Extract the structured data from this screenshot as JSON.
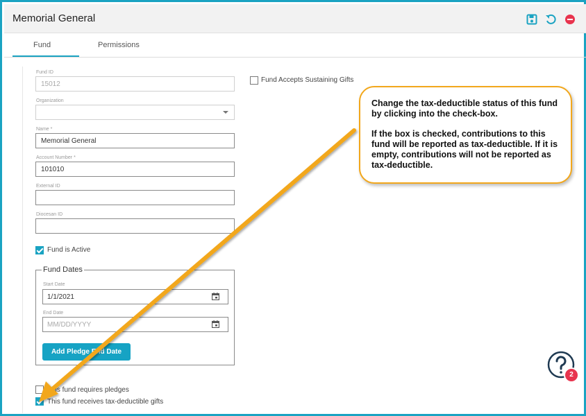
{
  "header": {
    "title": "Memorial General",
    "save_icon": "save-icon",
    "undo_icon": "undo-icon",
    "delete_icon": "remove-icon"
  },
  "tabs": [
    {
      "label": "Fund",
      "active": true
    },
    {
      "label": "Permissions",
      "active": false
    }
  ],
  "form": {
    "fund_id": {
      "label": "Fund ID",
      "value": "15012"
    },
    "organization": {
      "label": "Organization",
      "value": ""
    },
    "name": {
      "label": "Name *",
      "value": "Memorial General"
    },
    "account_number": {
      "label": "Account Number *",
      "value": "101010"
    },
    "external_id": {
      "label": "External ID",
      "value": ""
    },
    "diocesan_id": {
      "label": "Diocesan ID",
      "value": ""
    },
    "fund_is_active": {
      "label": "Fund is Active",
      "checked": true
    },
    "sustaining_gifts": {
      "label": "Fund Accepts Sustaining Gifts",
      "checked": false
    },
    "fund_dates": {
      "legend": "Fund Dates",
      "start_date": {
        "label": "Start Date",
        "value": "1/1/2021"
      },
      "end_date": {
        "label": "End Date",
        "placeholder": "MM/DD/YYYY"
      },
      "add_pledge_button": "Add Pledge End Date"
    },
    "requires_pledges": {
      "label": "This fund requires pledges",
      "checked": false
    },
    "tax_deductible": {
      "label": "This fund receives tax-deductible gifts",
      "checked": true
    }
  },
  "callout": {
    "line1": "Change the tax-deductible status of this fund by clicking into the check-box.",
    "line2": "If the box is checked, contributions to this fund will be reported as tax-deductible. If it is empty, contributions will not be reported as tax-deductible."
  },
  "help": {
    "icon": "question-icon",
    "badge_count": "2"
  },
  "colors": {
    "accent": "#1aa3c2",
    "callout_border": "#f2a71b",
    "arrow": "#f2a71b",
    "badge": "#e8344e"
  }
}
